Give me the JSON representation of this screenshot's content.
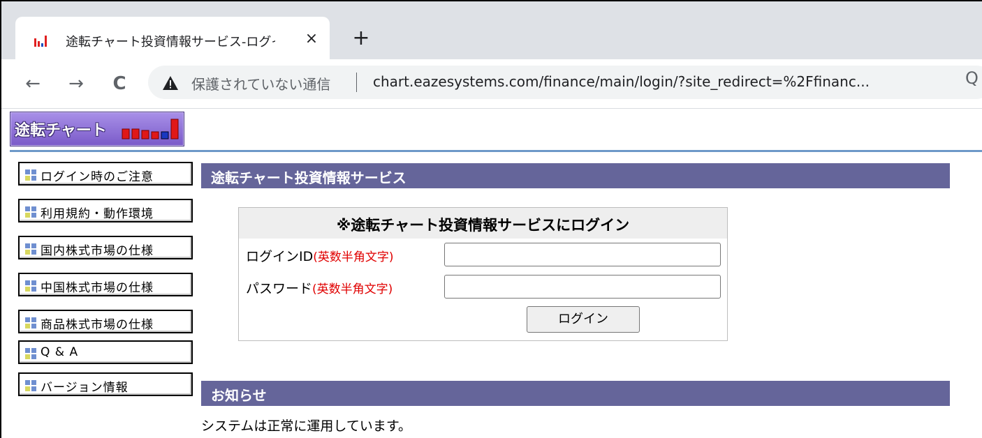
{
  "browser": {
    "tab_title": "途転チャート投資情報サービス-ログイン",
    "close_glyph": "×",
    "new_tab_glyph": "+",
    "back_glyph": "←",
    "forward_glyph": "→",
    "reload_glyph": "C",
    "security_label": "保護されていない通信",
    "url": "chart.eazesystems.com/finance/main/login/?site_redirect=%2Ffinanc...",
    "zoom_glyph": "Q"
  },
  "logo": {
    "text": "途転チャート"
  },
  "sidebar": {
    "items": [
      {
        "label": "ログイン時のご注意"
      },
      {
        "label": "利用規約・動作環境"
      },
      {
        "label": "国内株式市場の仕様"
      },
      {
        "label": "中国株式市場の仕様"
      },
      {
        "label": "商品株式市場の仕様"
      },
      {
        "label": "Q & A"
      },
      {
        "label": "バージョン情報"
      }
    ]
  },
  "main": {
    "section_title": "途転チャート投資情報サービス",
    "login": {
      "title": "※途転チャート投資情報サービスにログイン",
      "id_label": "ログインID",
      "id_hint": "(英数半角文字)",
      "password_label": "パスワード",
      "password_hint": "(英数半角文字)",
      "button_label": "ログイン"
    },
    "notice": {
      "title": "お知らせ",
      "text": "システムは正常に運用しています。"
    }
  },
  "colors": {
    "section_bar": "#65659a",
    "hint_red": "#e00000",
    "divider_blue": "#6d99c8",
    "logo_purple": "#7a5ac8"
  }
}
